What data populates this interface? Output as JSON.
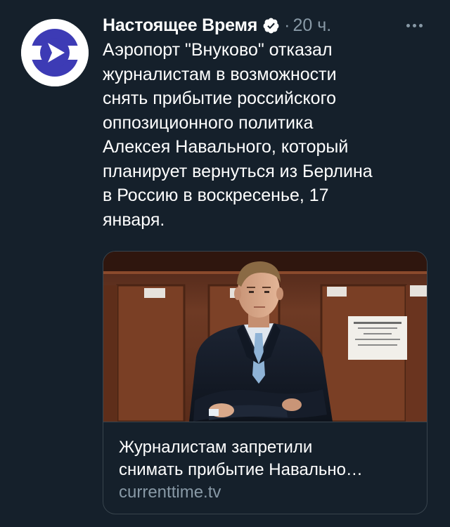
{
  "tweet": {
    "author_name": "Настоящее Время",
    "verified": true,
    "separator": "·",
    "time": "20 ч.",
    "more_icon": "more-horizontal-icon",
    "avatar_icon": "current-time-logo",
    "text_lines": [
      "Аэропорт \"Внуково\" отказал",
      "журналистам в возможности",
      "снять прибытие российского",
      "оппозиционного политика",
      "Алексея Навального, который",
      "планирует вернуться из Берлина",
      "в Россию в воскресенье, 17",
      "января."
    ]
  },
  "link_card": {
    "title_lines": [
      "Журналистам запретили",
      "снимать прибытие Навально…"
    ],
    "domain": "currenttime.tv"
  },
  "colors": {
    "background": "#15202b",
    "text_primary": "#ffffff",
    "text_secondary": "#8899a6",
    "border": "#38444d",
    "brand": "#3d3bb5"
  }
}
